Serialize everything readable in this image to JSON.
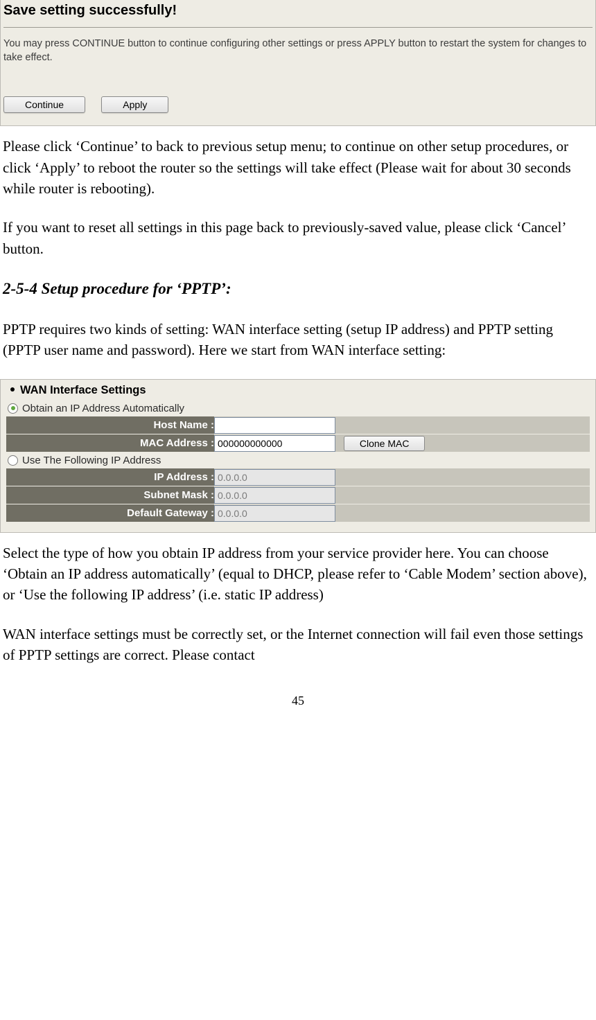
{
  "savePanel": {
    "title": "Save setting successfully!",
    "desc": "You may press CONTINUE button to continue configuring other settings or press APPLY button to restart the system for changes to take effect.",
    "continueLabel": "Continue",
    "applyLabel": "Apply"
  },
  "body": {
    "p1": "Please click ‘Continue’ to back to previous setup menu; to continue on other setup procedures, or click ‘Apply’ to reboot the router so the settings will take effect (Please wait for about 30 seconds while router is rebooting).",
    "p2": "If you want to reset all settings in this page back to previously-saved value, please click ‘Cancel’ button.",
    "heading": "2-5-4 Setup procedure for ‘PPTP’:",
    "p3": "PPTP requires two kinds of setting: WAN interface setting (setup IP address) and PPTP setting (PPTP user name and password). Here we start from WAN interface setting:",
    "p4": "Select the type of how you obtain IP address from your service provider here. You can choose ‘Obtain an IP address automatically’ (equal to DHCP, please refer to ‘Cable Modem’ section above), or ‘Use the following IP address’ (i.e. static IP address)",
    "p5": "WAN interface settings must be correctly set, or the Internet connection will fail even those settings of PPTP settings are correct. Please contact"
  },
  "wanPanel": {
    "title": "WAN Interface Settings",
    "radioAuto": "Obtain an IP Address Automatically",
    "radioStatic": "Use The Following IP Address",
    "autoSelected": true,
    "hostNameLabel": "Host Name :",
    "hostNameValue": "",
    "macLabel": "MAC Address :",
    "macValue": "000000000000",
    "cloneLabel": "Clone MAC",
    "ipLabel": "IP Address :",
    "ipValue": "0.0.0.0",
    "subnetLabel": "Subnet Mask :",
    "subnetValue": "0.0.0.0",
    "gatewayLabel": "Default Gateway :",
    "gatewayValue": "0.0.0.0"
  },
  "pageNumber": "45"
}
